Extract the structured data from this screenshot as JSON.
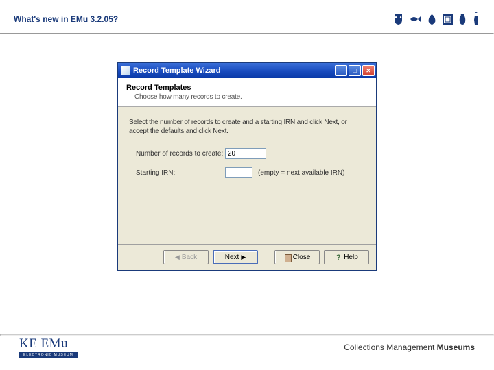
{
  "header": {
    "title": "What's new in EMu 3.2.05?"
  },
  "wizard": {
    "titlebar": "Record Template Wizard",
    "section_title": "Record Templates",
    "section_subtitle": "Choose how many records to create.",
    "instructions": "Select the number of records to create and a starting IRN and click Next, or accept the defaults and click Next.",
    "fields": {
      "num_records": {
        "label": "Number of records to create:",
        "value": "20"
      },
      "starting_irn": {
        "label": "Starting IRN:",
        "value": "",
        "hint": "(empty = next available IRN)"
      }
    },
    "buttons": {
      "back": "Back",
      "next": "Next",
      "close": "Close",
      "help": "Help"
    }
  },
  "footer": {
    "logo_main": "KE EMu",
    "logo_sub": "ELECTRONIC MUSEUM",
    "tagline_prefix": "Collections Management ",
    "tagline_bold": "Museums"
  }
}
